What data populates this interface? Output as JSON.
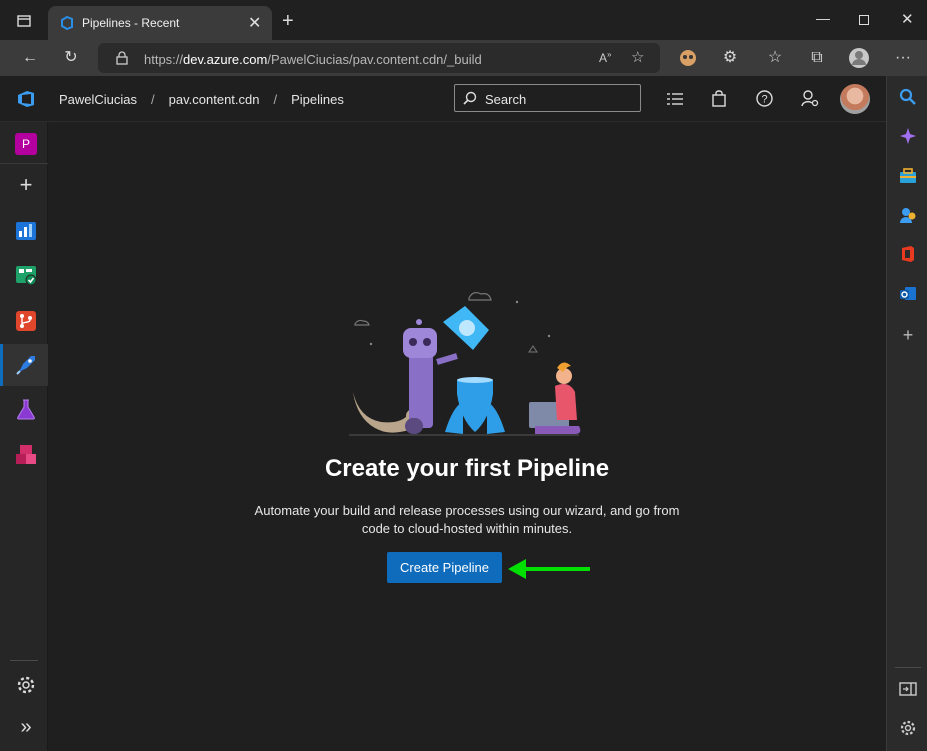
{
  "browser": {
    "tab_title": "Pipelines - Recent",
    "url_prefix": "https://",
    "url_host": "dev.azure.com",
    "url_path": "/PawelCiucias/pav.content.cdn/_build"
  },
  "header": {
    "breadcrumbs": [
      "PawelCiucias",
      "pav.content.cdn",
      "Pipelines"
    ],
    "search_placeholder": "Search"
  },
  "leftnav": {
    "project_initial": "P",
    "items": [
      "add-icon",
      "overview-icon",
      "boards-icon",
      "repos-icon",
      "pipelines-icon",
      "test-plans-icon",
      "artifacts-icon"
    ]
  },
  "main": {
    "title": "Create your first Pipeline",
    "description": "Automate your build and release processes using our wizard, and go from code to cloud-hosted within minutes.",
    "create_button": "Create Pipeline"
  },
  "colors": {
    "accent": "#0f6cbd",
    "annotation_arrow": "#00e000"
  }
}
